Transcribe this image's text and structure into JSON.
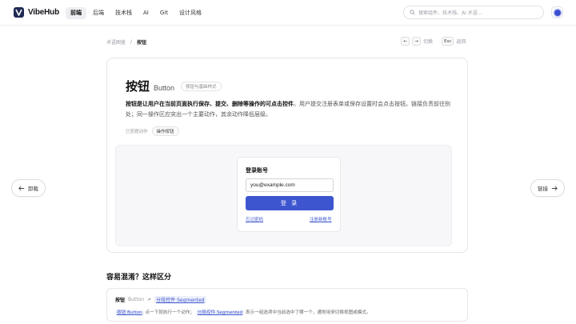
{
  "header": {
    "brand": "VibeHub",
    "nav": [
      "前端",
      "后端",
      "技术栈",
      "AI",
      "Git",
      "设计风格"
    ],
    "active_nav": "前端",
    "search_placeholder": "搜索组件、技术栈、AI 术语..."
  },
  "breadcrumb": {
    "parent": "术语图鉴",
    "sep": "/",
    "current": "按钮"
  },
  "pager": {
    "prev_key": "←",
    "next_key": "→",
    "switch_label": "切换",
    "esc_key": "Esc",
    "back_label": "返回"
  },
  "term": {
    "title_cn": "按钮",
    "title_en": "Button",
    "badge": "按钮与基础样式",
    "desc_bold": "按钮是让用户在当前页面执行保存、提交、删除等操作的可点击控件",
    "desc_rest": "。用户提交注册表单或保存设置时会点击按钮。链接负责前往别处；同一操作区应突出一个主要动作，其余动作降低层级。",
    "tags_label": "已答题动作",
    "tag": "操作按钮"
  },
  "demo": {
    "login_title": "登录账号",
    "input_value": "you@example.com",
    "submit_label": "登 录",
    "forgot_link": "忘记密码",
    "register_link": "注册新账号"
  },
  "side_nav": {
    "prev_label": "卸载",
    "next_label": "链接"
  },
  "confusion": {
    "section_title": "容易混淆？这样区分",
    "term_a_cn": "按钮",
    "term_a_en": "Button",
    "neq": "≠",
    "term_b": "分段控件 Segmented",
    "explain_a": "按钮 Button",
    "explain_mid": "点一下就执行一个动作；",
    "explain_b": "分段控件 Segmented",
    "explain_rest": "表示一组选项中当前选中了哪一个，通常用来切换视图或模式。"
  }
}
